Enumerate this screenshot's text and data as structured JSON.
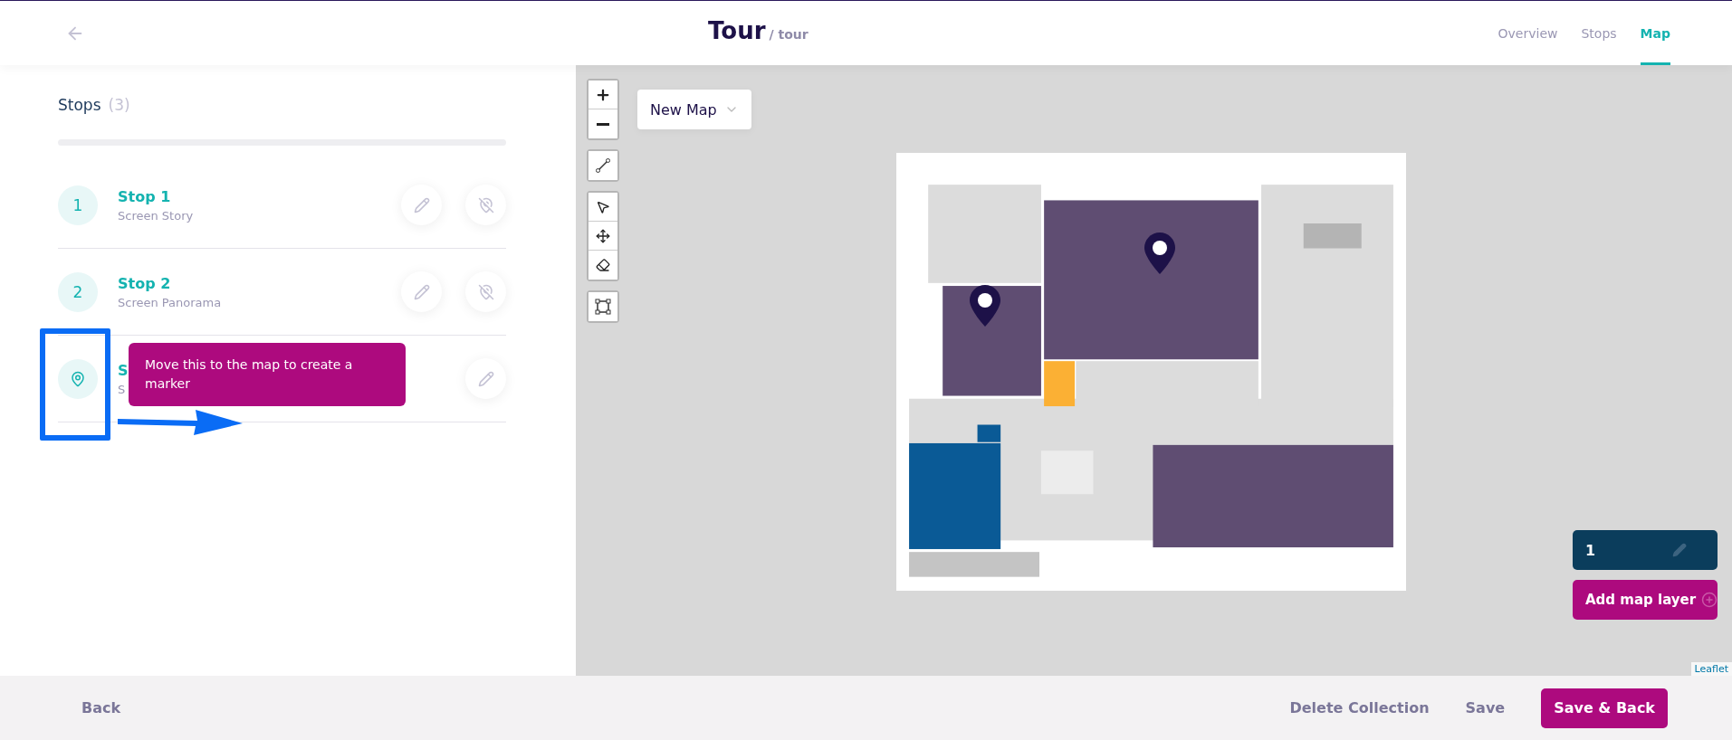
{
  "header": {
    "title": "Tour",
    "subtitle": "/ tour",
    "nav": [
      {
        "label": "Overview",
        "selected": false
      },
      {
        "label": "Stops",
        "selected": false
      },
      {
        "label": "Map",
        "selected": true
      }
    ]
  },
  "stops_panel": {
    "heading": "Stops",
    "count": "(3)",
    "stops": [
      {
        "kind": "number",
        "badge": "1",
        "title": "Stop 1",
        "subtitle": "Screen Story",
        "can_hide": true
      },
      {
        "kind": "number",
        "badge": "2",
        "title": "Stop 2",
        "subtitle": "Screen Panorama",
        "can_hide": true
      },
      {
        "kind": "pin",
        "title": "S",
        "subtitle": "S",
        "can_hide": false
      }
    ],
    "tooltip": "Move this to the map to create a marker"
  },
  "map": {
    "map_select": "New Map",
    "layers": [
      {
        "label": "1",
        "selected": true
      }
    ],
    "add_layer": "Add map layer",
    "attribution": "Leaflet"
  },
  "footer": {
    "back": "Back",
    "delete": "Delete Collection",
    "save": "Save",
    "save_back": "Save & Back"
  }
}
